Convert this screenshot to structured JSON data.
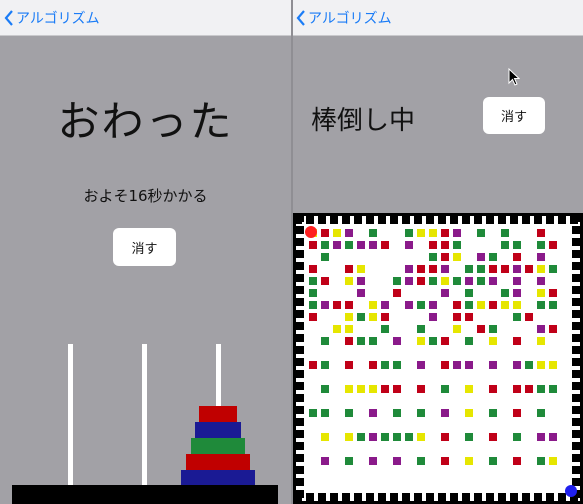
{
  "left": {
    "nav": {
      "back_label": "アルゴリズム"
    },
    "title": "おわった",
    "estimate": "およそ16秒かかる",
    "clear_label": "消す",
    "hanoi": {
      "pegs": 3,
      "disks_on_right_peg_top_to_bottom": [
        {
          "color": "#c00000"
        },
        {
          "color": "#1a1a94"
        },
        {
          "color": "#1f8a3a"
        },
        {
          "color": "#c00000"
        },
        {
          "color": "#1a1a94"
        }
      ]
    }
  },
  "right": {
    "nav": {
      "back_label": "アルゴリズム"
    },
    "status": "棒倒し中",
    "clear_label": "消す",
    "maze": {
      "start_color": "#ff2020",
      "goal_color": "#2020ee",
      "palette": [
        "#c00018",
        "#1f8a3a",
        "#e6e600",
        "#8a1a8a"
      ]
    }
  },
  "colors": {
    "background": "#a2a1a6",
    "accent": "#1b7cf6",
    "nav_bg": "#f1f1f3"
  }
}
